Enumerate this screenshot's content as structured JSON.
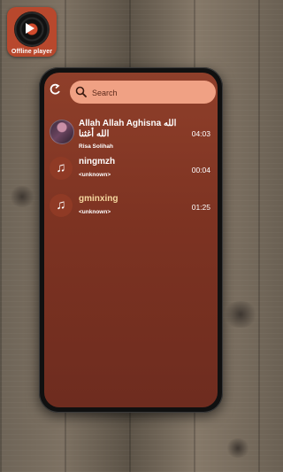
{
  "app_badge": {
    "label": "Offline player",
    "icon": "vinyl-record-icon"
  },
  "search": {
    "placeholder": "Search",
    "back_icon": "back-arrow-icon",
    "search_icon": "magnifier-icon"
  },
  "songs": [
    {
      "title": "Allah Allah Aghisna الله الله أغثنا",
      "artist": "Risa Solihah",
      "duration": "04:03",
      "artwork": "album-photo",
      "highlighted": false
    },
    {
      "title": "ningmzh",
      "artist": "<unknown>",
      "duration": "00:04",
      "artwork": "music-note-icon",
      "highlighted": false
    },
    {
      "title": "gminxing",
      "artist": "<unknown>",
      "duration": "01:25",
      "artwork": "music-note-icon",
      "highlighted": true
    }
  ],
  "colors": {
    "accent": "#f0a184",
    "screen_background": "#7d3322",
    "highlight_title": "#f6d9a0"
  }
}
